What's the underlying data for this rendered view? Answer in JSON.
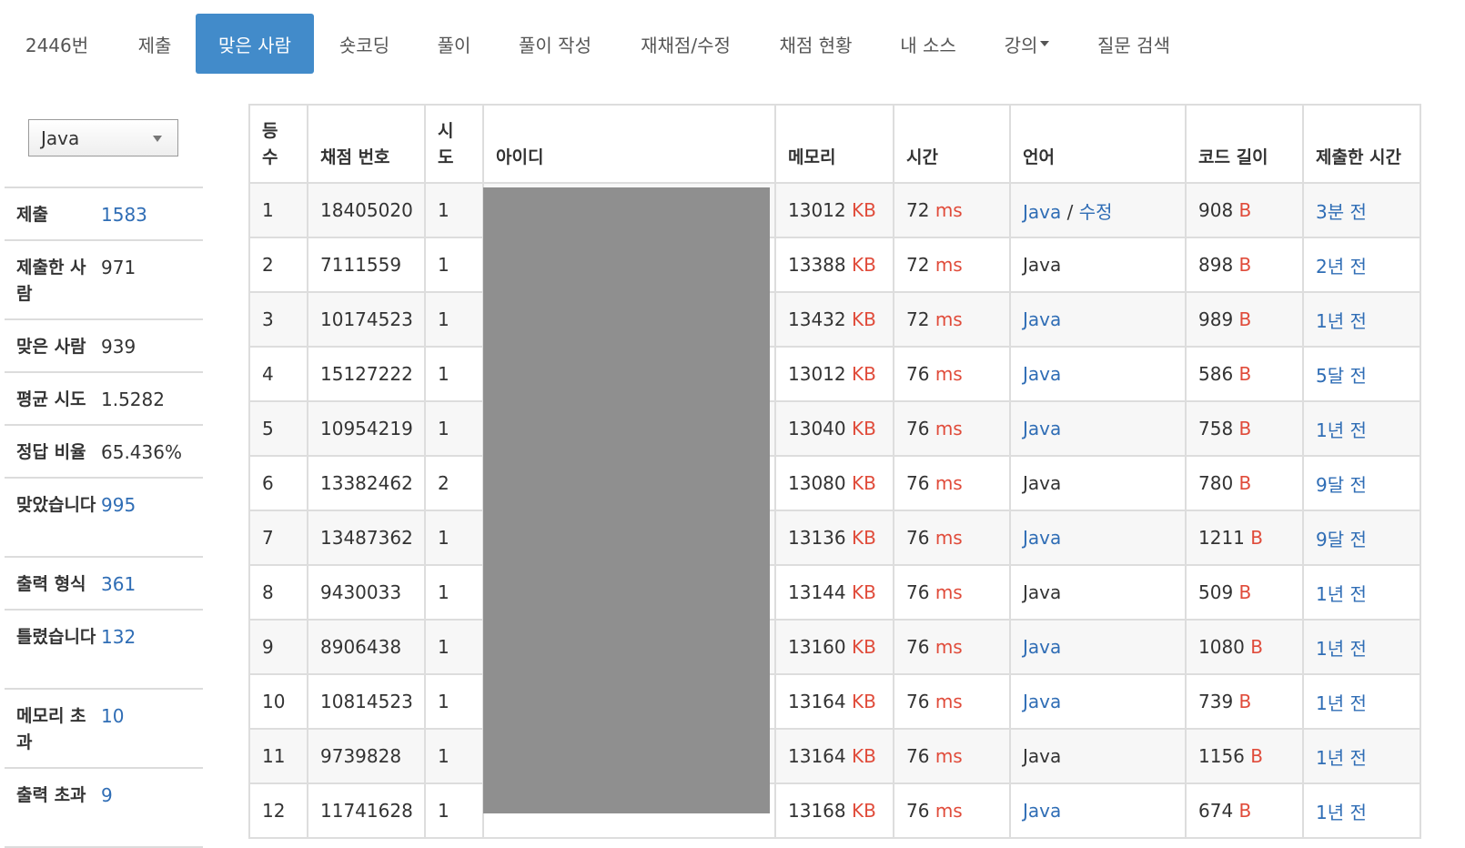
{
  "nav": {
    "items": [
      {
        "label": "2446번",
        "active": false
      },
      {
        "label": "제출",
        "active": false
      },
      {
        "label": "맞은 사람",
        "active": true
      },
      {
        "label": "숏코딩",
        "active": false
      },
      {
        "label": "풀이",
        "active": false
      },
      {
        "label": "풀이 작성",
        "active": false
      },
      {
        "label": "재채점/수정",
        "active": false
      },
      {
        "label": "채점 현황",
        "active": false
      },
      {
        "label": "내 소스",
        "active": false
      },
      {
        "label": "강의",
        "active": false,
        "dropdown": true
      },
      {
        "label": "질문 검색",
        "active": false
      }
    ]
  },
  "sidebar": {
    "language_select": {
      "value": "Java"
    },
    "stats": [
      {
        "label": "제출",
        "value": "1583",
        "link": true
      },
      {
        "label": "제출한 사람",
        "value": "971",
        "link": false
      },
      {
        "label": "맞은 사람",
        "value": "939",
        "link": false
      },
      {
        "label": "평균 시도",
        "value": "1.5282",
        "link": false
      },
      {
        "label": "정답 비율",
        "value": "65.436%",
        "link": false
      },
      {
        "label": "맞았습니다",
        "value": "995",
        "link": true
      },
      {
        "label": "출력 형식",
        "value": "361",
        "link": true
      },
      {
        "label": "틀렸습니다",
        "value": "132",
        "link": true
      },
      {
        "label": "메모리 초과",
        "value": "10",
        "link": true
      },
      {
        "label": "출력 초과",
        "value": "9",
        "link": true
      }
    ]
  },
  "table": {
    "headers": [
      "등수",
      "채점 번호",
      "시도",
      "아이디",
      "메모리",
      "시간",
      "언어",
      "코드 길이",
      "제출한 시간"
    ],
    "units": {
      "memory": "KB",
      "time": "ms",
      "length": "B"
    },
    "edit_link": "수정",
    "rows": [
      {
        "rank": "1",
        "id": "18405020",
        "tries": "1",
        "memory": "13012",
        "time": "72",
        "lang": "Java",
        "lang_link": true,
        "edit": true,
        "length": "908",
        "when": "3분 전"
      },
      {
        "rank": "2",
        "id": "7111559",
        "tries": "1",
        "memory": "13388",
        "time": "72",
        "lang": "Java",
        "lang_link": false,
        "edit": false,
        "length": "898",
        "when": "2년 전"
      },
      {
        "rank": "3",
        "id": "10174523",
        "tries": "1",
        "memory": "13432",
        "time": "72",
        "lang": "Java",
        "lang_link": true,
        "edit": false,
        "length": "989",
        "when": "1년 전"
      },
      {
        "rank": "4",
        "id": "15127222",
        "tries": "1",
        "memory": "13012",
        "time": "76",
        "lang": "Java",
        "lang_link": true,
        "edit": false,
        "length": "586",
        "when": "5달 전"
      },
      {
        "rank": "5",
        "id": "10954219",
        "tries": "1",
        "memory": "13040",
        "time": "76",
        "lang": "Java",
        "lang_link": true,
        "edit": false,
        "length": "758",
        "when": "1년 전"
      },
      {
        "rank": "6",
        "id": "13382462",
        "tries": "2",
        "memory": "13080",
        "time": "76",
        "lang": "Java",
        "lang_link": false,
        "edit": false,
        "length": "780",
        "when": "9달 전"
      },
      {
        "rank": "7",
        "id": "13487362",
        "tries": "1",
        "memory": "13136",
        "time": "76",
        "lang": "Java",
        "lang_link": true,
        "edit": false,
        "length": "1211",
        "when": "9달 전"
      },
      {
        "rank": "8",
        "id": "9430033",
        "tries": "1",
        "memory": "13144",
        "time": "76",
        "lang": "Java",
        "lang_link": false,
        "edit": false,
        "length": "509",
        "when": "1년 전"
      },
      {
        "rank": "9",
        "id": "8906438",
        "tries": "1",
        "memory": "13160",
        "time": "76",
        "lang": "Java",
        "lang_link": true,
        "edit": false,
        "length": "1080",
        "when": "1년 전"
      },
      {
        "rank": "10",
        "id": "10814523",
        "tries": "1",
        "memory": "13164",
        "time": "76",
        "lang": "Java",
        "lang_link": true,
        "edit": false,
        "length": "739",
        "when": "1년 전"
      },
      {
        "rank": "11",
        "id": "9739828",
        "tries": "1",
        "memory": "13164",
        "time": "76",
        "lang": "Java",
        "lang_link": false,
        "edit": false,
        "length": "1156",
        "when": "1년 전"
      },
      {
        "rank": "12",
        "id": "11741628",
        "tries": "1",
        "memory": "13168",
        "time": "76",
        "lang": "Java",
        "lang_link": true,
        "edit": false,
        "length": "674",
        "when": "1년 전"
      }
    ]
  }
}
